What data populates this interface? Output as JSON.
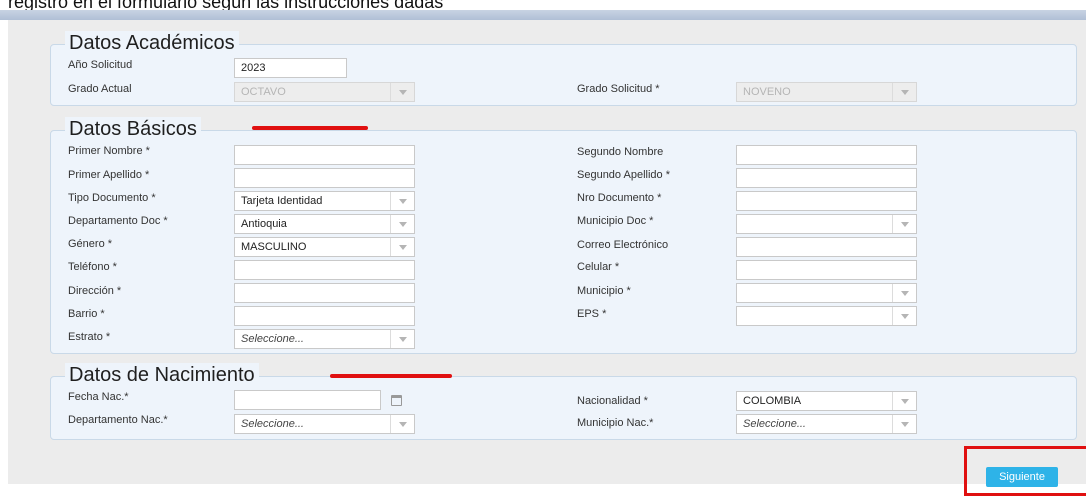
{
  "top_caption": "registro en el formulario según las instrucciones dadas",
  "academicos": {
    "title": "Datos Académicos",
    "anio_label": "Año Solicitud",
    "anio_value": "2023",
    "grado_actual_label": "Grado Actual",
    "grado_actual_value": "OCTAVO",
    "grado_solicitud_label": "Grado Solicitud *",
    "grado_solicitud_value": "NOVENO"
  },
  "basicos": {
    "title": "Datos Básicos",
    "primer_nombre_label": "Primer Nombre *",
    "segundo_nombre_label": "Segundo Nombre",
    "primer_apellido_label": "Primer Apellido *",
    "segundo_apellido_label": "Segundo Apellido *",
    "tipo_documento_label": "Tipo Documento *",
    "tipo_documento_value": "Tarjeta Identidad",
    "nro_documento_label": "Nro Documento *",
    "departamento_doc_label": "Departamento Doc *",
    "departamento_doc_value": "Antioquia",
    "municipio_doc_label": "Municipio Doc *",
    "genero_label": "Género *",
    "genero_value": "MASCULINO",
    "correo_label": "Correo Electrónico",
    "telefono_label": "Teléfono *",
    "celular_label": "Celular *",
    "direccion_label": "Dirección *",
    "municipio_label": "Municipio *",
    "barrio_label": "Barrio *",
    "eps_label": "EPS *",
    "estrato_label": "Estrato *",
    "estrato_value": "Seleccione..."
  },
  "nacimiento": {
    "title": "Datos de Nacimiento",
    "fecha_label": "Fecha Nac.*",
    "nacionalidad_label": "Nacionalidad *",
    "nacionalidad_value": "COLOMBIA",
    "departamento_label": "Departamento Nac.*",
    "departamento_value": "Seleccione...",
    "municipio_label": "Municipio Nac.*",
    "municipio_value": "Seleccione..."
  },
  "actions": {
    "next_label": "Siguiente"
  },
  "icons": {
    "dropdown": "chevron-down-icon",
    "calendar": "calendar-icon"
  },
  "colors": {
    "primary_button": "#2eb3e8",
    "annotation_red": "#e01010",
    "section_bg": "#eef4fb"
  }
}
